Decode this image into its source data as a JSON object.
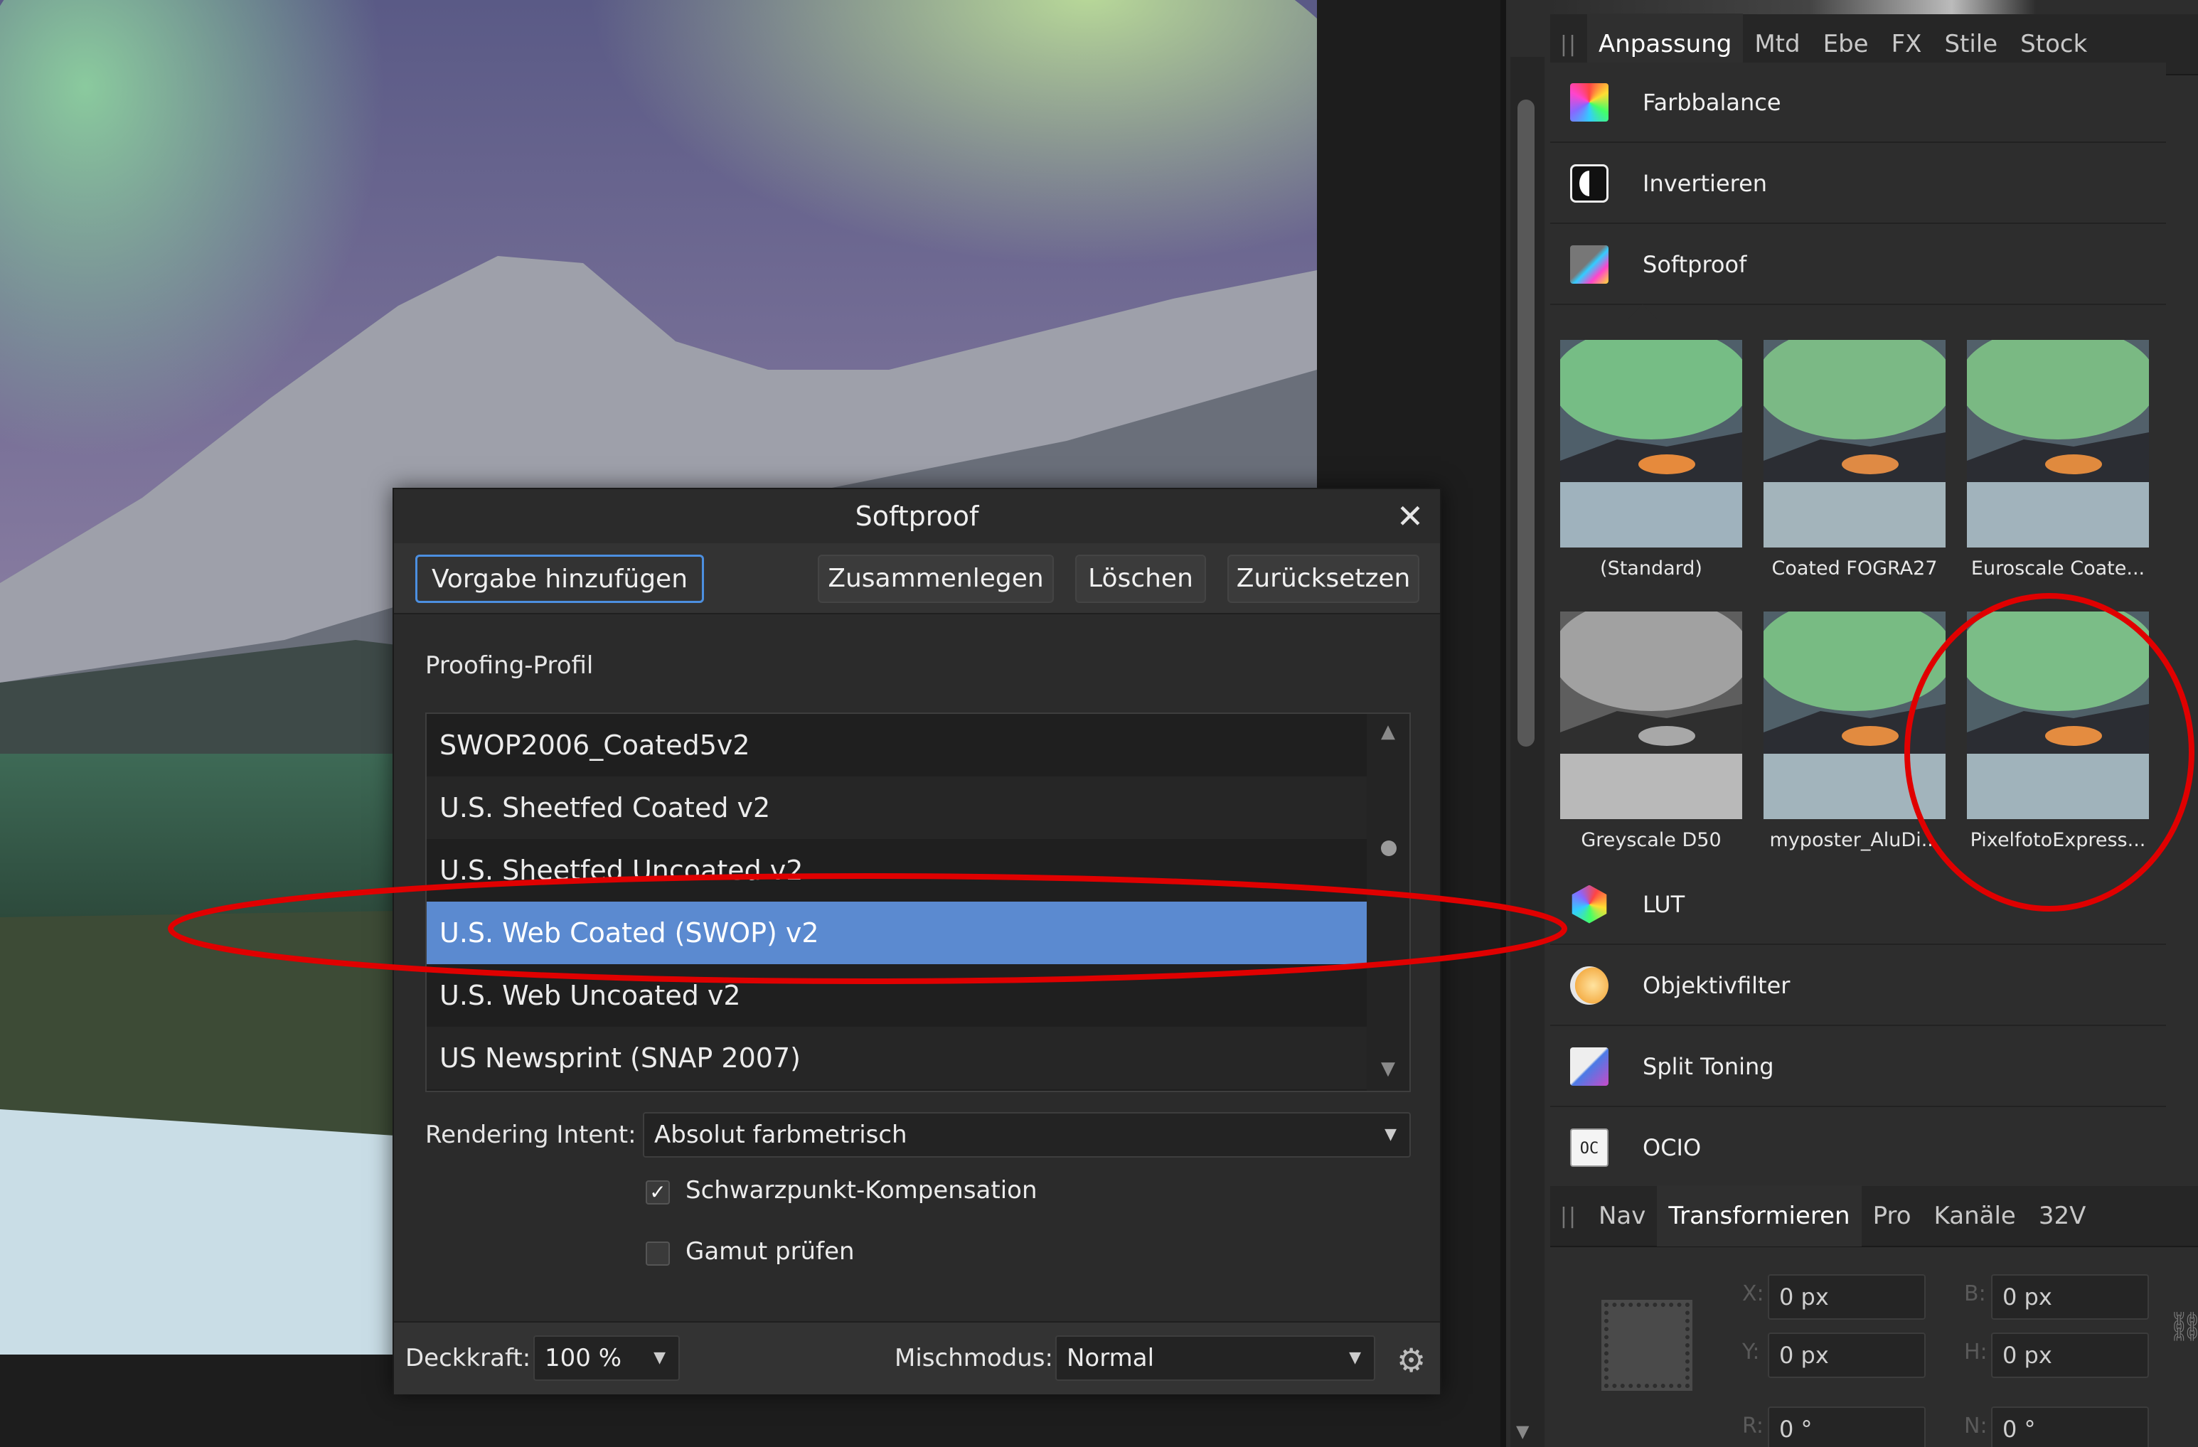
{
  "dialog": {
    "title": "Softproof",
    "buttons": {
      "add_preset": "Vorgabe hinzufügen",
      "merge": "Zusammenlegen",
      "delete": "Löschen",
      "reset": "Zurücksetzen"
    },
    "profile_label": "Proofing-Profil",
    "profiles": [
      {
        "name": "SWOP2006_Coated5v2",
        "selected": false
      },
      {
        "name": "U.S. Sheetfed Coated v2",
        "selected": false
      },
      {
        "name": "U.S. Sheetfed Uncoated v2",
        "selected": false
      },
      {
        "name": "U.S. Web Coated (SWOP) v2",
        "selected": true
      },
      {
        "name": "U.S. Web Uncoated v2",
        "selected": false
      },
      {
        "name": "US Newsprint (SNAP 2007)",
        "selected": false
      }
    ],
    "rendering_intent_label": "Rendering Intent:",
    "rendering_intent_value": "Absolut farbmetrisch",
    "blackpoint_label": "Schwarzpunkt-Kompensation",
    "blackpoint_checked": true,
    "gamut_label": "Gamut prüfen",
    "gamut_checked": false,
    "opacity_label": "Deckkraft:",
    "opacity_value": "100 %",
    "blend_label": "Mischmodus:",
    "blend_value": "Normal"
  },
  "studio": {
    "top_tabs": [
      "Anpassung",
      "Mtd",
      "Ebe",
      "FX",
      "Stile",
      "Stock"
    ],
    "top_active": "Anpassung",
    "adjustments_above": [
      {
        "label": "Farbbalance",
        "icon": "color-balance-icon"
      },
      {
        "label": "Invertieren",
        "icon": "invert-icon"
      },
      {
        "label": "Softproof",
        "icon": "softproof-icon"
      }
    ],
    "presets": [
      {
        "label": "(Standard)",
        "style": "aurora"
      },
      {
        "label": "Coated FOGRA27",
        "style": "aurora"
      },
      {
        "label": "Euroscale Coate...",
        "style": "aurora"
      },
      {
        "label": "Greyscale D50",
        "style": "grey"
      },
      {
        "label": "myposter_AluDi...",
        "style": "aurora"
      },
      {
        "label": "PixelfotoExpress...",
        "style": "aurora"
      }
    ],
    "adjustments_below": [
      {
        "label": "LUT",
        "icon": "lut-icon"
      },
      {
        "label": "Objektivfilter",
        "icon": "lens-filter-icon"
      },
      {
        "label": "Split Toning",
        "icon": "split-toning-icon"
      },
      {
        "label": "OCIO",
        "icon": "ocio-icon"
      }
    ],
    "ocio_icon_text": "OC",
    "bottom_tabs": [
      "Nav",
      "Transformieren",
      "Pro",
      "Kanäle",
      "32V"
    ],
    "bottom_active": "Transformieren",
    "transform": {
      "x_label": "X:",
      "x": "0 px",
      "y_label": "Y:",
      "y": "0 px",
      "w_label": "B:",
      "w": "0 px",
      "h_label": "H:",
      "h": "0 px",
      "r_label": "R:",
      "r": "0 °",
      "s_label": "N:",
      "s": "0 °"
    }
  },
  "colors": {
    "selection": "#5b8ad0",
    "annotation": "#e00000",
    "panel": "#2d2d2d"
  }
}
